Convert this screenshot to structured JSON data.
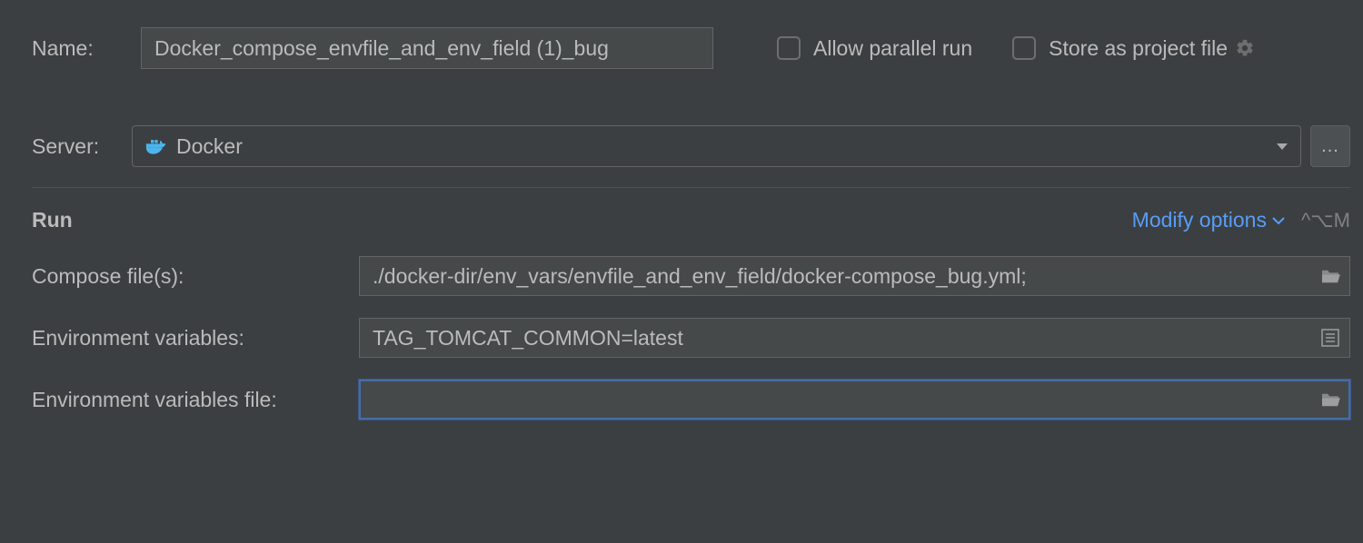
{
  "header": {
    "name_label": "Name:",
    "name_value": "Docker_compose_envfile_and_env_field (1)_bug",
    "allow_parallel_label": "Allow parallel run",
    "allow_parallel_checked": false,
    "store_project_label": "Store as project file",
    "store_project_checked": false
  },
  "server": {
    "label": "Server:",
    "selected": "Docker",
    "browse_label": "..."
  },
  "run_section": {
    "title": "Run",
    "modify_options_label": "Modify options",
    "shortcut": "^⌥M",
    "fields": {
      "compose_files_label": "Compose file(s):",
      "compose_files_value": "./docker-dir/env_vars/envfile_and_env_field/docker-compose_bug.yml;",
      "env_vars_label": "Environment variables:",
      "env_vars_value": "TAG_TOMCAT_COMMON=latest",
      "env_vars_file_label": "Environment variables file:",
      "env_vars_file_value": ""
    }
  }
}
